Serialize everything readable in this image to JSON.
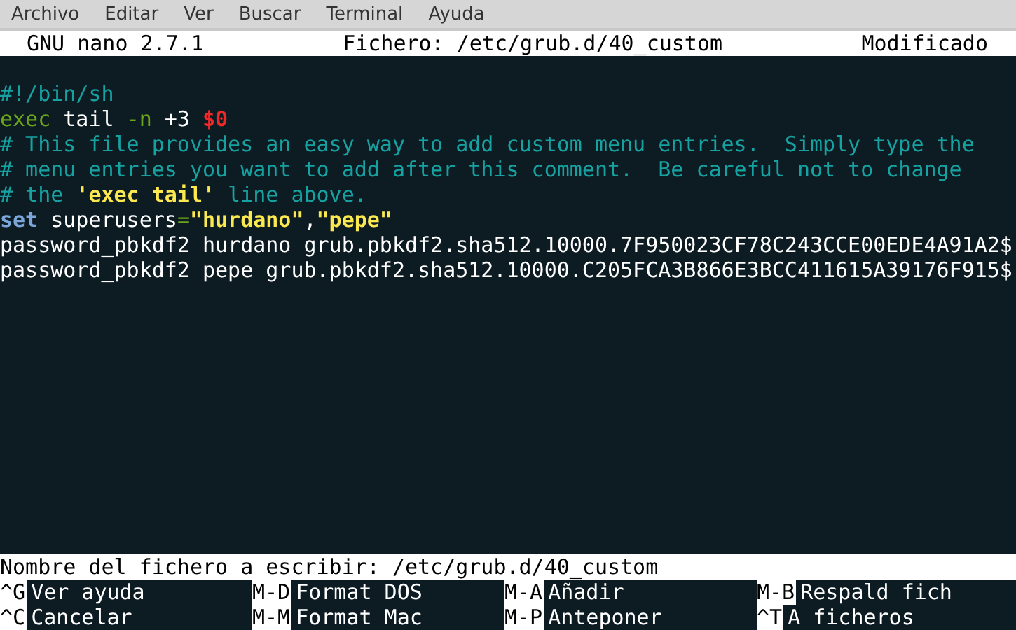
{
  "menu_bar": [
    "Archivo",
    "Editar",
    "Ver",
    "Buscar",
    "Terminal",
    "Ayuda"
  ],
  "title_bar": {
    "app": "GNU nano 2.7.1",
    "file": "Fichero: /etc/grub.d/40_custom",
    "status": "Modificado"
  },
  "lines": [
    [
      {
        "kind": "comment",
        "text": "#!/bin/sh"
      }
    ],
    [
      {
        "kind": "keyword",
        "text": "exec"
      },
      {
        "kind": "plain",
        "text": " tail "
      },
      {
        "kind": "option",
        "text": "-n"
      },
      {
        "kind": "plain",
        "text": " +3 "
      },
      {
        "kind": "variable",
        "text": "$0"
      }
    ],
    [
      {
        "kind": "comment",
        "text": "# This file provides an easy way to add custom menu entries.  Simply type the"
      }
    ],
    [
      {
        "kind": "comment",
        "text": "# menu entries you want to add after this comment.  Be careful not to change"
      }
    ],
    [
      {
        "kind": "comment",
        "text": "# the "
      },
      {
        "kind": "string",
        "text": "'exec tail'"
      },
      {
        "kind": "comment",
        "text": " line above."
      }
    ],
    [
      {
        "kind": "builtin",
        "text": "set"
      },
      {
        "kind": "plain",
        "text": " superusers"
      },
      {
        "kind": "option",
        "text": "="
      },
      {
        "kind": "string",
        "text": "\"hurdano\""
      },
      {
        "kind": "plain",
        "text": ","
      },
      {
        "kind": "string",
        "text": "\"pepe\""
      }
    ],
    [
      {
        "kind": "plain",
        "text": "password_pbkdf2 hurdano grub.pbkdf2.sha512.10000.7F950023CF78C243CCE00EDE4A91A2$"
      }
    ],
    [
      {
        "kind": "plain",
        "text": "password_pbkdf2 pepe grub.pbkdf2.sha512.10000.C205FCA3B866E3BCC411615A39176F915$"
      }
    ]
  ],
  "prompt": "Nombre del fichero a escribir: /etc/grub.d/40_custom",
  "shortcuts": [
    [
      {
        "key": "^G",
        "label": "Ver ayuda"
      },
      {
        "key": "M-D",
        "label": "Format DOS"
      },
      {
        "key": "M-A",
        "label": "Añadir"
      },
      {
        "key": "M-B",
        "label": "Respald fich"
      }
    ],
    [
      {
        "key": "^C",
        "label": "Cancelar"
      },
      {
        "key": "M-M",
        "label": "Format Mac"
      },
      {
        "key": "M-P",
        "label": "Anteponer"
      },
      {
        "key": "^T",
        "label": "A ficheros"
      }
    ]
  ]
}
